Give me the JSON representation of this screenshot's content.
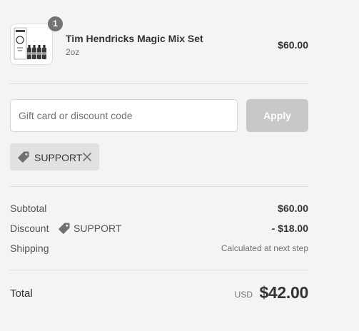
{
  "line_item": {
    "quantity": "1",
    "name": "Tim Hendricks Magic Mix Set",
    "variant": "2oz",
    "price": "$60.00"
  },
  "discount_form": {
    "placeholder": "Gift card or discount code",
    "value": "",
    "apply_label": "Apply"
  },
  "applied_reduction": {
    "code": "SUPPORT"
  },
  "summary": {
    "subtotal_label": "Subtotal",
    "subtotal_value": "$60.00",
    "discount_label": "Discount",
    "discount_code": "SUPPORT",
    "discount_value": "- $18.00",
    "shipping_label": "Shipping",
    "shipping_value": "Calculated at next step"
  },
  "total": {
    "label": "Total",
    "currency": "USD",
    "amount": "$42.00"
  },
  "colors": {
    "background": "#f4f4f4",
    "apply_disabled": "#c8c8c8",
    "tag_background": "#e1e1e1",
    "quantity_badge": "#737373"
  }
}
